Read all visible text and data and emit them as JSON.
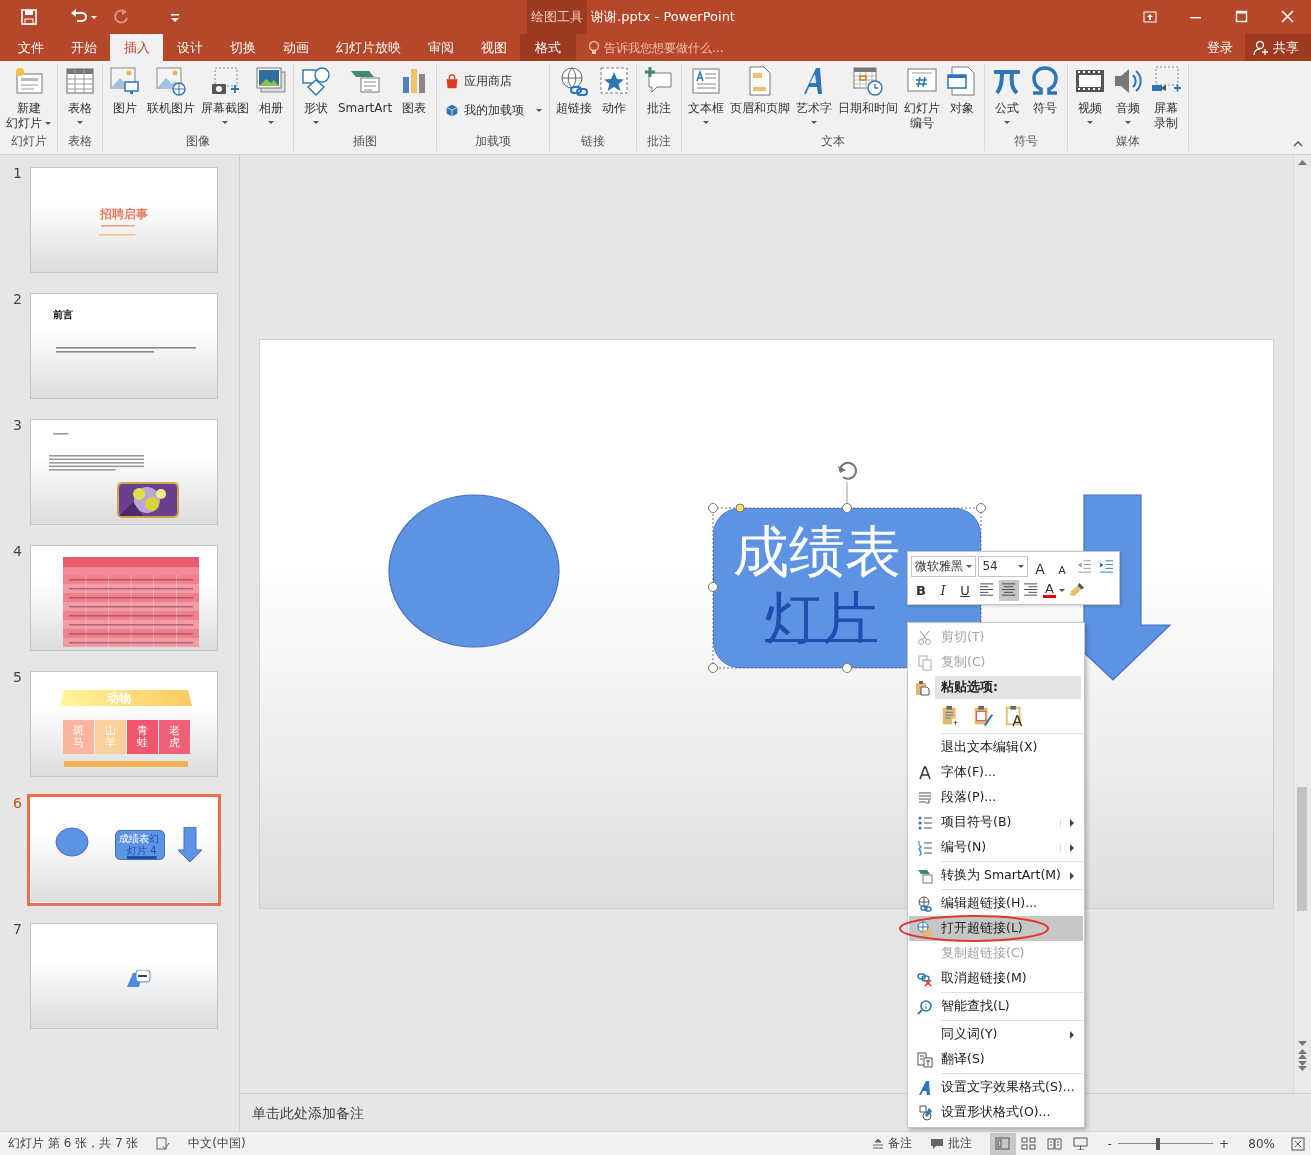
{
  "window": {
    "title": "谢谢.pptx - PowerPoint",
    "context_tab": "绘图工具"
  },
  "quick_access": [
    {
      "kind": "save",
      "disabled": false
    },
    {
      "kind": "undo",
      "disabled": false
    },
    {
      "kind": "redo",
      "disabled": true
    },
    {
      "kind": "customize",
      "disabled": false
    }
  ],
  "ribbon_tabs": [
    {
      "label": "文件",
      "selected": false,
      "kind": "normal"
    },
    {
      "label": "开始",
      "selected": false,
      "kind": "normal"
    },
    {
      "label": "插入",
      "selected": true,
      "kind": "normal"
    },
    {
      "label": "设计",
      "selected": false,
      "kind": "normal"
    },
    {
      "label": "切换",
      "selected": false,
      "kind": "normal"
    },
    {
      "label": "动画",
      "selected": false,
      "kind": "normal"
    },
    {
      "label": "幻灯片放映",
      "selected": false,
      "kind": "normal"
    },
    {
      "label": "审阅",
      "selected": false,
      "kind": "normal"
    },
    {
      "label": "视图",
      "selected": false,
      "kind": "normal"
    },
    {
      "label": "格式",
      "selected": false,
      "kind": "contextual"
    }
  ],
  "tell_me": {
    "placeholder": "告诉我您想要做什么..."
  },
  "account": {
    "sign_in": "登录",
    "share": "共享"
  },
  "ribbon_groups": [
    {
      "label": "幻灯片",
      "buttons": [
        {
          "lines": [
            "新建",
            "幻灯片"
          ],
          "kind": "large",
          "dropdown": true
        }
      ]
    },
    {
      "label": "表格",
      "buttons": [
        {
          "lines": [
            "表格"
          ],
          "kind": "large",
          "dropdown": true
        }
      ]
    },
    {
      "label": "图像",
      "buttons": [
        {
          "lines": [
            "图片"
          ],
          "kind": "large",
          "dropdown": false
        },
        {
          "lines": [
            "联机图片"
          ],
          "kind": "large",
          "dropdown": false
        },
        {
          "lines": [
            "屏幕截图"
          ],
          "kind": "large",
          "dropdown": true
        },
        {
          "lines": [
            "相册"
          ],
          "kind": "large",
          "dropdown": true
        }
      ]
    },
    {
      "label": "插图",
      "buttons": [
        {
          "lines": [
            "形状"
          ],
          "kind": "large",
          "dropdown": true
        },
        {
          "lines": [
            "SmartArt"
          ],
          "kind": "large",
          "dropdown": false
        },
        {
          "lines": [
            "图表"
          ],
          "kind": "large",
          "dropdown": false
        }
      ]
    },
    {
      "label": "加载项",
      "buttons": [
        {
          "lines": [
            "应用商店"
          ],
          "kind": "small",
          "dropdown": false
        },
        {
          "lines": [
            "我的加载项"
          ],
          "kind": "small",
          "dropdown": true
        }
      ]
    },
    {
      "label": "链接",
      "buttons": [
        {
          "lines": [
            "超链接"
          ],
          "kind": "large",
          "dropdown": false
        },
        {
          "lines": [
            "动作"
          ],
          "kind": "large",
          "dropdown": false
        }
      ]
    },
    {
      "label": "批注",
      "buttons": [
        {
          "lines": [
            "批注"
          ],
          "kind": "large",
          "dropdown": false
        }
      ]
    },
    {
      "label": "文本",
      "buttons": [
        {
          "lines": [
            "文本框"
          ],
          "kind": "large",
          "dropdown": true
        },
        {
          "lines": [
            "页眉和页脚"
          ],
          "kind": "large",
          "dropdown": false
        },
        {
          "lines": [
            "艺术字"
          ],
          "kind": "large",
          "dropdown": true
        },
        {
          "lines": [
            "日期和时间"
          ],
          "kind": "large",
          "dropdown": false
        },
        {
          "lines": [
            "幻灯片",
            "编号"
          ],
          "kind": "large",
          "dropdown": false
        },
        {
          "lines": [
            "对象"
          ],
          "kind": "large",
          "dropdown": false
        }
      ]
    },
    {
      "label": "符号",
      "buttons": [
        {
          "lines": [
            "公式"
          ],
          "kind": "large",
          "dropdown": true
        },
        {
          "lines": [
            "符号"
          ],
          "kind": "large",
          "dropdown": false
        }
      ]
    },
    {
      "label": "媒体",
      "buttons": [
        {
          "lines": [
            "视频"
          ],
          "kind": "large",
          "dropdown": true
        },
        {
          "lines": [
            "音频"
          ],
          "kind": "large",
          "dropdown": true
        },
        {
          "lines": [
            "屏幕",
            "录制"
          ],
          "kind": "large",
          "dropdown": false
        }
      ]
    }
  ],
  "slides": [
    {
      "number": "1",
      "selected": false,
      "kind": "title",
      "title": "招聘启事"
    },
    {
      "number": "2",
      "selected": false,
      "kind": "heading",
      "title": "前言"
    },
    {
      "number": "3",
      "selected": false,
      "kind": "text-picture"
    },
    {
      "number": "4",
      "selected": false,
      "kind": "table"
    },
    {
      "number": "5",
      "selected": false,
      "kind": "animals",
      "title": "动物",
      "items": [
        "斑马",
        "山羊",
        "青蛙",
        "老虎"
      ]
    },
    {
      "number": "6",
      "selected": true,
      "kind": "shapes",
      "text": "成绩表",
      "link": "幻",
      "link_line2": "灯片 4"
    },
    {
      "number": "7",
      "selected": false,
      "kind": "shape-note"
    }
  ],
  "slide": {
    "text": "成绩表",
    "link_line2": "灯片",
    "shape_selected": true
  },
  "mini_toolbar": {
    "font": "微软雅黑",
    "size": "54",
    "row1": [
      {
        "kind": "grow",
        "label": "A"
      },
      {
        "kind": "shrink",
        "label": "A"
      },
      {
        "kind": "outdent"
      },
      {
        "kind": "indent"
      }
    ],
    "row2": [
      {
        "kind": "bold",
        "label": "B",
        "selected": false
      },
      {
        "kind": "italic",
        "label": "I",
        "selected": false
      },
      {
        "kind": "underline",
        "label": "U",
        "selected": false
      },
      {
        "kind": "align-left",
        "selected": false
      },
      {
        "kind": "align-center",
        "selected": true
      },
      {
        "kind": "align-right",
        "selected": false
      },
      {
        "kind": "font-color",
        "label": "A",
        "selected": false
      },
      {
        "kind": "painter",
        "selected": false
      }
    ]
  },
  "context_menu": [
    {
      "kind": "item",
      "label": "剪切(T)",
      "disabled": true,
      "selected": false,
      "submenu": false,
      "circled": false,
      "separator": false
    },
    {
      "kind": "item",
      "label": "复制(C)",
      "disabled": true,
      "selected": false,
      "submenu": false,
      "circled": false,
      "separator": false
    },
    {
      "kind": "header",
      "label": "粘贴选项:",
      "disabled": false,
      "selected": false,
      "submenu": false,
      "circled": false,
      "separator": false
    },
    {
      "kind": "paste-options",
      "disabled": false,
      "selected": false,
      "submenu": false,
      "circled": false,
      "separator": false
    },
    {
      "kind": "item",
      "label": "退出文本编辑(X)",
      "disabled": false,
      "selected": false,
      "submenu": false,
      "circled": false,
      "separator": true
    },
    {
      "kind": "item",
      "label": "字体(F)...",
      "disabled": false,
      "selected": false,
      "submenu": false,
      "circled": false,
      "separator": false
    },
    {
      "kind": "item",
      "label": "段落(P)...",
      "disabled": false,
      "selected": false,
      "submenu": false,
      "circled": false,
      "separator": false
    },
    {
      "kind": "item",
      "label": "项目符号(B)",
      "disabled": false,
      "selected": false,
      "submenu": true,
      "circled": false,
      "separator": false
    },
    {
      "kind": "item",
      "label": "编号(N)",
      "disabled": false,
      "selected": false,
      "submenu": true,
      "circled": false,
      "separator": false
    },
    {
      "kind": "item",
      "label": "转换为 SmartArt(M)",
      "disabled": false,
      "selected": false,
      "submenu": true,
      "circled": false,
      "separator": true
    },
    {
      "kind": "item",
      "label": "编辑超链接(H)...",
      "disabled": false,
      "selected": false,
      "submenu": false,
      "circled": false,
      "separator": true
    },
    {
      "kind": "item",
      "label": "打开超链接(L)",
      "disabled": false,
      "selected": true,
      "submenu": false,
      "circled": true,
      "separator": false
    },
    {
      "kind": "item",
      "label": "复制超链接(C)",
      "disabled": true,
      "selected": false,
      "submenu": false,
      "circled": false,
      "separator": false
    },
    {
      "kind": "item",
      "label": "取消超链接(M)",
      "disabled": false,
      "selected": false,
      "submenu": false,
      "circled": false,
      "separator": false
    },
    {
      "kind": "item",
      "label": "智能查找(L)",
      "disabled": false,
      "selected": false,
      "submenu": false,
      "circled": false,
      "separator": true
    },
    {
      "kind": "item",
      "label": "同义词(Y)",
      "disabled": false,
      "selected": false,
      "submenu": true,
      "circled": false,
      "separator": true
    },
    {
      "kind": "item",
      "label": "翻译(S)",
      "disabled": false,
      "selected": false,
      "submenu": false,
      "circled": false,
      "separator": false
    },
    {
      "kind": "item",
      "label": "设置文字效果格式(S)...",
      "disabled": false,
      "selected": false,
      "submenu": false,
      "circled": false,
      "separator": true
    },
    {
      "kind": "item",
      "label": "设置形状格式(O)...",
      "disabled": false,
      "selected": false,
      "submenu": false,
      "circled": false,
      "separator": false
    }
  ],
  "notes": {
    "placeholder": "单击此处添加备注"
  },
  "status_bar": {
    "slide_info": "幻灯片 第 6 张，共 7 张",
    "language": "中文(中国)",
    "notes": "备注",
    "comments": "批注",
    "views": [
      {
        "selected": true
      },
      {
        "selected": false
      },
      {
        "selected": false
      },
      {
        "selected": false
      }
    ],
    "zoom_out": "-",
    "zoom_in": "+",
    "zoom": {
      "level": 0.42,
      "reading": "80%"
    }
  }
}
